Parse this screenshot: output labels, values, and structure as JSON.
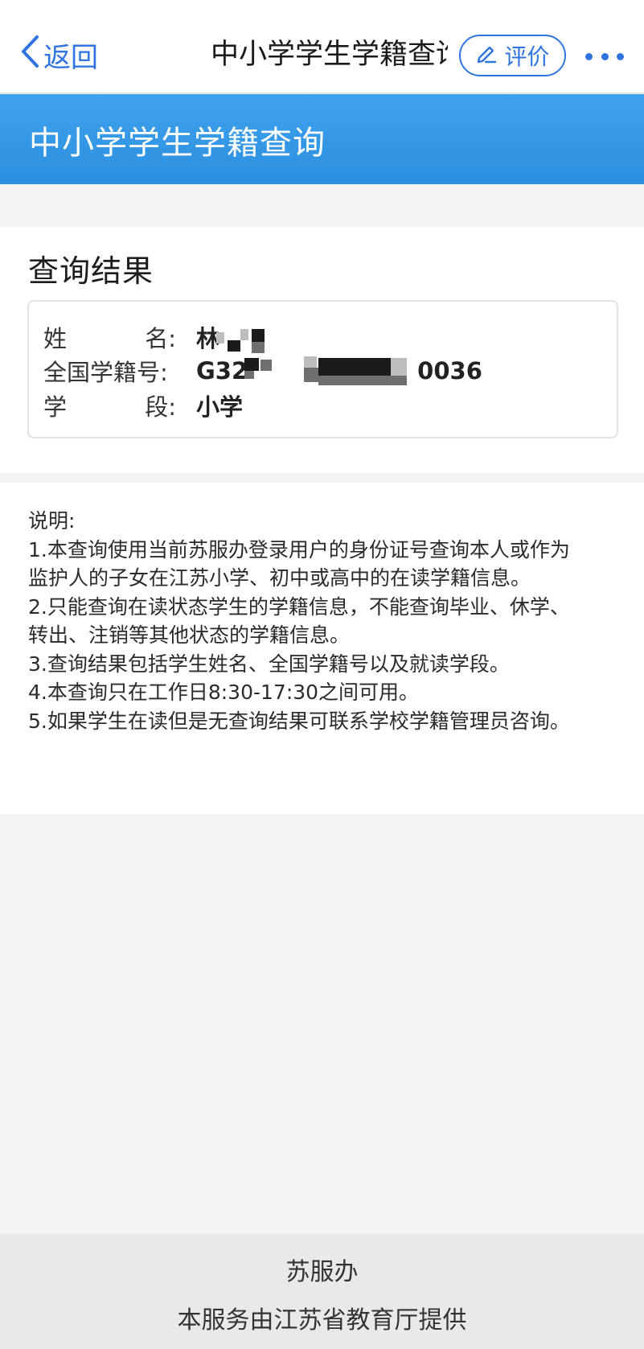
{
  "nav": {
    "back_label": "返回",
    "title": "中小学学生学籍查询",
    "rate_label": "评价",
    "accent_color": "#2f74e0"
  },
  "header": {
    "title": "中小学学生学籍查询",
    "color": "#3fa3ee"
  },
  "result": {
    "heading": "查询结果",
    "fields": [
      {
        "label_chars": [
          "姓",
          "名"
        ],
        "suffix": ":",
        "value_visible_start": "林",
        "value_visible_end": ""
      },
      {
        "label": "全国学籍号:",
        "value_visible_start": "G32",
        "value_visible_end": "0036"
      },
      {
        "label_chars": [
          "学",
          "段"
        ],
        "suffix": ":",
        "value": "小学"
      }
    ]
  },
  "description": {
    "title": "说明:",
    "lines": [
      "1.本查询使用当前苏服办登录用户的身份证号查询本人或作为",
      "监护人的子女在江苏小学、初中或高中的在读学籍信息。",
      "2.只能查询在读状态学生的学籍信息，不能查询毕业、休学、",
      "转出、注销等其他状态的学籍信息。",
      "3.查询结果包括学生姓名、全国学籍号以及就读学段。",
      "4.本查询只在工作日8:30-17:30之间可用。",
      "5.如果学生在读但是无查询结果可联系学校学籍管理员咨询。"
    ]
  },
  "footer": {
    "brand": "苏服办",
    "provider": "本服务由江苏省教育厅提供"
  }
}
